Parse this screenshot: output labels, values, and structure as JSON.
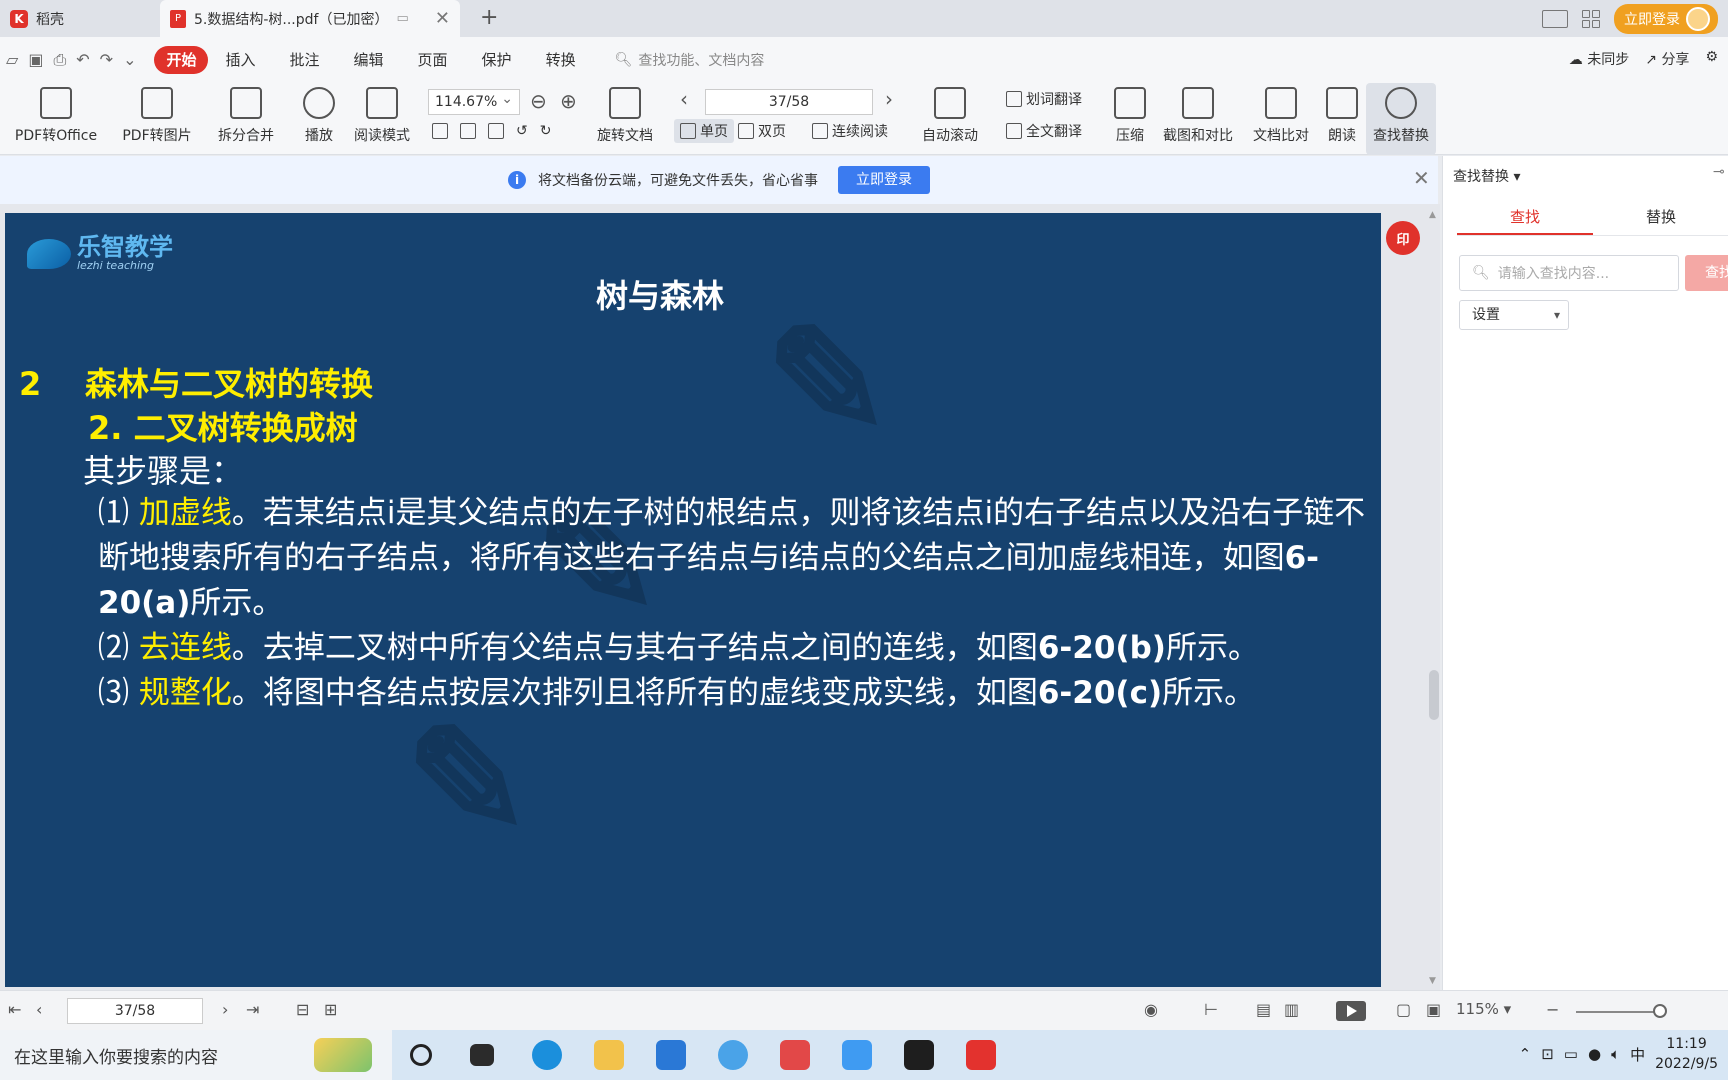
{
  "tabs": {
    "home_label": "稻壳",
    "active_label": "5.数据结构-树...pdf（已加密）"
  },
  "titlebar": {
    "login_label": "立即登录"
  },
  "menu": {
    "items": [
      "开始",
      "插入",
      "批注",
      "编辑",
      "页面",
      "保护",
      "转换"
    ],
    "search_placeholder": "查找功能、文档内容",
    "sync_label": "未同步",
    "share_label": "分享"
  },
  "ribbon": {
    "pdf_to_office": "PDF转Office",
    "pdf_to_image": "PDF转图片",
    "split_merge": "拆分合并",
    "play": "播放",
    "read_mode": "阅读模式",
    "zoom_value": "114.67%",
    "rotate": "旋转文档",
    "page_value": "37/58",
    "single_page": "单页",
    "double_page": "双页",
    "continuous": "连续阅读",
    "auto_scroll": "自动滚动",
    "word_translate": "划词翻译",
    "full_translate": "全文翻译",
    "compress": "压缩",
    "screenshot_compare": "截图和对比",
    "doc_compare": "文档比对",
    "read_aloud": "朗读",
    "find_replace": "查找替换"
  },
  "notice": {
    "text": "将文档备份云端，可避免文件丢失，省心省事",
    "button": "立即登录"
  },
  "slide": {
    "logo_cn": "乐智教学",
    "logo_en": "lezhi teaching",
    "title": "树与森林",
    "section_num": "2",
    "section_title": "森林与二叉树的转换",
    "subsection": "2. 二叉树转换成树",
    "intro": "其步骤是：",
    "step1_num": "⑴",
    "step1_key": "加虚线",
    "step1_text": "。若某结点i是其父结点的左子树的根结点，则将该结点i的右子结点以及沿右子链不断地搜索所有的右子结点，将所有这些右子结点与i结点的父结点之间加虚线相连，如图",
    "step1_ref": "6-20(a)",
    "step1_end": "所示。",
    "step2_num": "⑵",
    "step2_key": "去连线",
    "step2_text": "。去掉二叉树中所有父结点与其右子结点之间的连线，如图",
    "step2_ref": "6-20(b)",
    "step2_end": "所示。",
    "step3_num": "⑶",
    "step3_key": "规整化",
    "step3_text": "。将图中各结点按层次排列且将所有的虚线变成实线，如图",
    "step3_ref": "6-20(c)",
    "step3_end": "所示。"
  },
  "panel": {
    "title": "查找替换",
    "tab_find": "查找",
    "tab_replace": "替换",
    "search_placeholder": "请输入查找内容...",
    "search_button": "查找",
    "setting": "设置"
  },
  "statusbar": {
    "page_value": "37/58",
    "zoom": "115%"
  },
  "taskbar": {
    "search_placeholder": "在这里输入你要搜索的内容",
    "ime": "中",
    "time": "11:19",
    "date": "2022/9/5"
  }
}
